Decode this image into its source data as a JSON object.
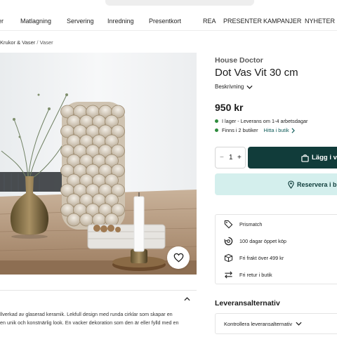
{
  "nav": {
    "items": [
      "er",
      "Matlagning",
      "Servering",
      "Inredning",
      "Presentkort",
      "REA",
      "PRESENTER",
      "KAMPANJER",
      "NYHETER"
    ]
  },
  "breadcrumb": {
    "parent": "Krukor & Vaser",
    "separator": "/",
    "current": "Vaser"
  },
  "product": {
    "brand": "House Doctor",
    "title": "Dot Vas Vit 30 cm",
    "description_toggle": "Beskrivning",
    "price": "950 kr",
    "stock_online": "I lager - Leverans om 1-4 arbetsdagar",
    "stock_stores": "Finns i 2 butiker",
    "store_link": "Hitta i butik",
    "quantity": "1",
    "add_to_cart": "Lägg i va",
    "reserve": "Reservera i but",
    "description_lines": [
      "llverkad av glaserad keramik. Lekfull design med runda cirklar som skapar en",
      "en unik och konstnärlig look. En vacker dekoration som den är eller fylld med en"
    ]
  },
  "usps": [
    {
      "icon": "tag-icon",
      "label": "Prismatch"
    },
    {
      "icon": "return-100-icon",
      "label": "100 dagar öppet köp"
    },
    {
      "icon": "delivery-box-icon",
      "label": "Fri frakt över 499 kr"
    },
    {
      "icon": "swap-arrows-icon",
      "label": "Fri retur i butik"
    }
  ],
  "delivery": {
    "heading": "Leveransalternativ",
    "check_label": "Kontrollera leveransalternativ"
  },
  "colors": {
    "primary_dark": "#113c3a",
    "reserve_bg": "#d4efed",
    "in_stock": "#2e8b3d",
    "link": "#0e5a58"
  }
}
